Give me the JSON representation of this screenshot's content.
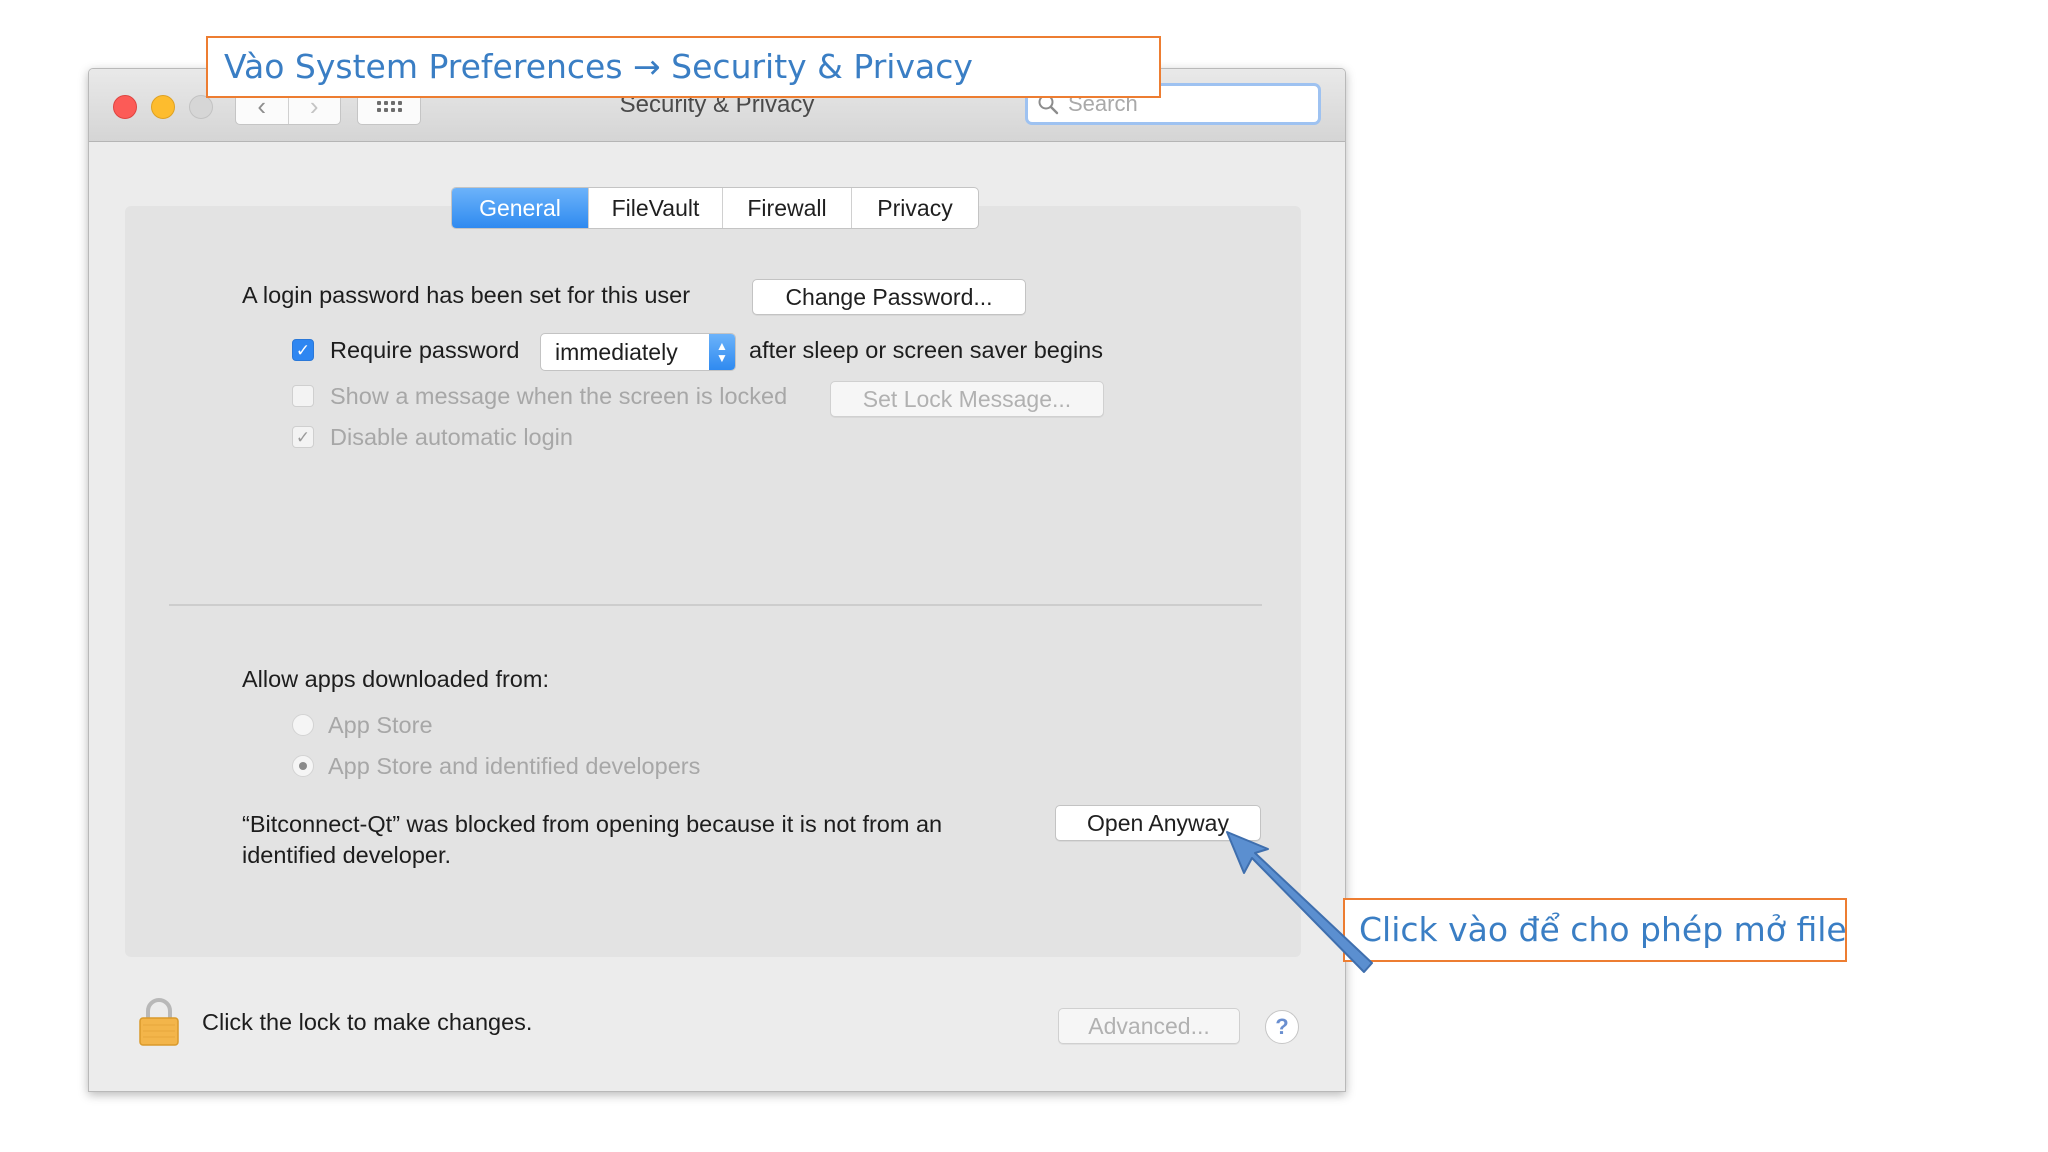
{
  "annotations": {
    "top_callout": "Vào System Preferences → Security & Privacy",
    "bottom_callout": "Click vào để cho phép mở file"
  },
  "window": {
    "title": "Security & Privacy",
    "nav_back_symbol": "‹",
    "nav_forward_symbol": "›",
    "search_placeholder": "Search"
  },
  "tabs": [
    {
      "label": "General",
      "active": true
    },
    {
      "label": "FileVault",
      "active": false
    },
    {
      "label": "Firewall",
      "active": false
    },
    {
      "label": "Privacy",
      "active": false
    }
  ],
  "general": {
    "login_password_text": "A login password has been set for this user",
    "change_password_button": "Change Password...",
    "require_password_label": "Require password",
    "require_password_checked": true,
    "require_password_interval": "immediately",
    "after_sleep_text": "after sleep or screen saver begins",
    "show_message_label": "Show a message when the screen is locked",
    "show_message_checked": false,
    "set_lock_message_button": "Set Lock Message...",
    "disable_auto_login_label": "Disable automatic login",
    "disable_auto_login_checked": true
  },
  "downloads": {
    "heading": "Allow apps downloaded from:",
    "options": [
      {
        "label": "App Store",
        "selected": false
      },
      {
        "label": "App Store and identified developers",
        "selected": true
      }
    ],
    "blocked_message_line1": "“Bitconnect-Qt” was blocked from opening because it is not from an",
    "blocked_message_line2": "identified developer.",
    "open_anyway_button": "Open Anyway"
  },
  "footer": {
    "lock_text": "Click the lock to make changes.",
    "advanced_button": "Advanced...",
    "help_button": "?"
  },
  "colors": {
    "accent_blue": "#2e86f1",
    "callout_border": "#ed7d31",
    "callout_text": "#3a7ec4",
    "arrow": "#5b8fd0"
  }
}
